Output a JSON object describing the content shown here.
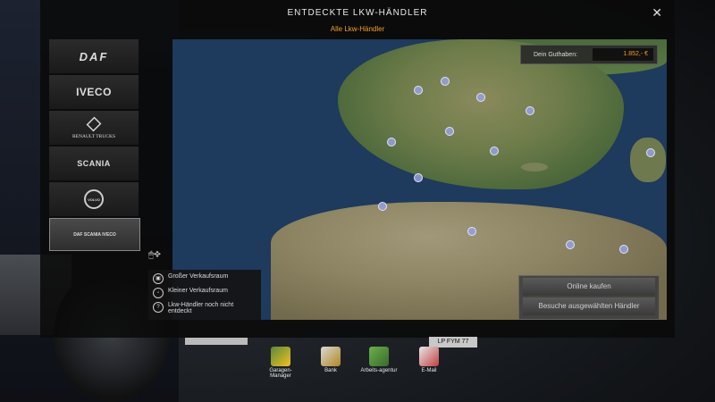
{
  "dialog": {
    "title": "ENTDECKTE LKW-HÄNDLER",
    "subtitle": "Alle Lkw-Händler",
    "close_icon": "close-icon"
  },
  "brands": [
    {
      "id": "daf",
      "label": "DAF"
    },
    {
      "id": "iveco",
      "label": "IVECO"
    },
    {
      "id": "renault",
      "label": "RENAULT TRUCKS"
    },
    {
      "id": "scania",
      "label": "SCANIA"
    },
    {
      "id": "volvo",
      "label": "VOLVO"
    },
    {
      "id": "all",
      "label": "DAF SCANIA IVECO"
    }
  ],
  "balance": {
    "label": "Dein Guthaben:",
    "value": "1.852,- €"
  },
  "actions": {
    "buy_online": "Online kaufen",
    "visit_dealer": "Besuche ausgewählten Händler"
  },
  "legend": {
    "large": "Großer Verkaufsraum",
    "small": "Kleiner Verkaufsraum",
    "undiscovered": "Lkw-Händler noch nicht entdeckt"
  },
  "bottom_nav": [
    {
      "label": "Garagen-Manager",
      "icon": "garage-icon"
    },
    {
      "label": "Bank",
      "icon": "bank-icon"
    },
    {
      "label": "Arbeits-agentur",
      "icon": "agency-icon"
    },
    {
      "label": "E-Mail",
      "icon": "email-icon"
    }
  ],
  "plate": "LP FYM 77"
}
